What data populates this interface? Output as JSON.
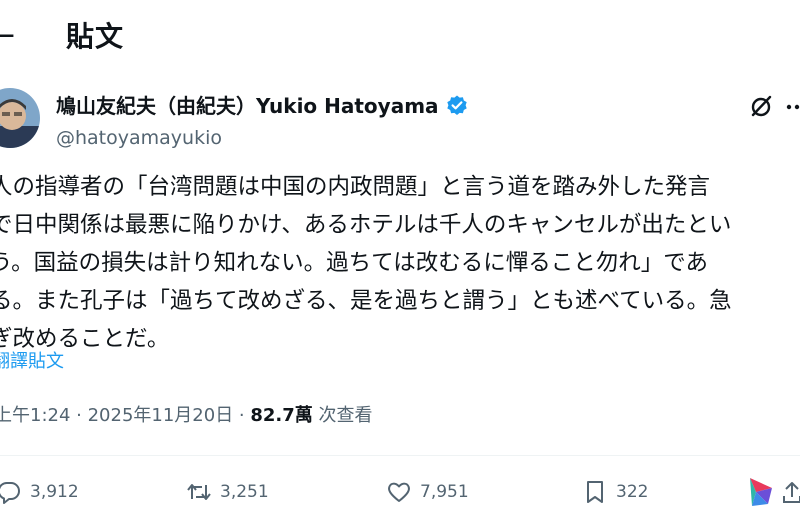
{
  "header": {
    "back_glyph": "←",
    "title": "貼文"
  },
  "author": {
    "name": "鳩山友紀夫（由紀夫）Yukio Hatoyama",
    "handle": "@hatoyamayukio",
    "verified_color": "#1d9bf0",
    "avatar_icon": "avatar"
  },
  "tweet": {
    "lines": [
      "人の指導者の「台湾問題は中国の内政問題」と言う道を踏み外した発言",
      "で日中関係は最悪に陥りかけ、あるホテルは千人のキャンセルが出たとい",
      "う。国益の損失は計り知れない。過ちては改むるに憚ること勿れ」であ",
      "る。また孔子は「過ちて改めざる、是を過ちと謂う」とも述べている。急",
      "ぎ改めることだ。"
    ],
    "translate_label": "翻譯貼文"
  },
  "meta": {
    "time_date": "上午1:24 · 2025年11月20日 · ",
    "views_count": "82.7萬",
    "views_label": " 次查看"
  },
  "actions": {
    "replies": "3,912",
    "retweets": "3,251",
    "likes": "7,951",
    "bookmarks": "322"
  },
  "colors": {
    "accent": "#1d9bf0",
    "secondary_text": "#536471",
    "primary_text": "#0f1419"
  }
}
